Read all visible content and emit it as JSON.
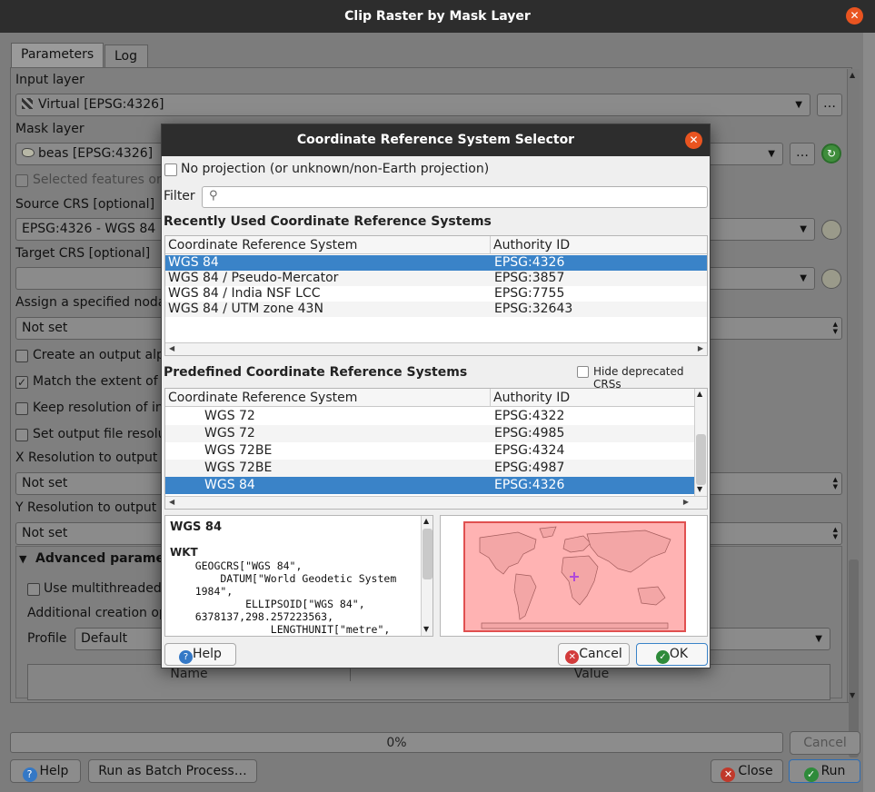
{
  "window": {
    "title": "Clip Raster by Mask Layer"
  },
  "tabs": [
    {
      "label": "Parameters",
      "active": true
    },
    {
      "label": "Log",
      "active": false
    }
  ],
  "params": {
    "input_layer_label": "Input layer",
    "input_layer_value": "Virtual [EPSG:4326]",
    "mask_layer_label": "Mask layer",
    "mask_layer_value": "beas [EPSG:4326]",
    "selected_features_label": "Selected features on",
    "source_crs_label": "Source CRS [optional]",
    "source_crs_value": "EPSG:4326 - WGS 84",
    "target_crs_label": "Target CRS [optional]",
    "target_crs_value": "",
    "nodata_label": "Assign a specified nodal",
    "nodata_value": "Not set",
    "alpha_label": "Create an output alp",
    "match_extent_label": "Match the extent of t",
    "keep_resolution_label": "Keep resolution of in",
    "set_resolution_label": "Set output file resolu",
    "x_res_label": "X Resolution to output l",
    "x_res_value": "Not set",
    "y_res_label": "Y Resolution to output l",
    "y_res_value": "Not set",
    "advanced_label": "Advanced paramete",
    "multithreaded_label": "Use multithreaded",
    "creation_options_label": "Additional creation op",
    "profile_label": "Profile",
    "profile_value": "Default",
    "table_headers": [
      "Name",
      "Value"
    ],
    "browse_btn": "…"
  },
  "bottom": {
    "progress_text": "0%",
    "progress_value": 0,
    "cancel": "Cancel",
    "help": "Help",
    "batch": "Run as Batch Process…",
    "close": "Close",
    "run": "Run"
  },
  "dialog": {
    "title": "Coordinate Reference System Selector",
    "no_projection": "No projection (or unknown/non-Earth projection)",
    "filter_label": "Filter",
    "filter_value": "",
    "recent_title": "Recently Used Coordinate Reference Systems",
    "col_crs": "Coordinate Reference System",
    "col_auth": "Authority ID",
    "recent_rows": [
      {
        "name": "WGS 84",
        "auth": "EPSG:4326",
        "selected": true
      },
      {
        "name": "WGS 84 / Pseudo-Mercator",
        "auth": "EPSG:3857"
      },
      {
        "name": "WGS 84 / India NSF LCC",
        "auth": "EPSG:7755"
      },
      {
        "name": "WGS 84 / UTM zone 43N",
        "auth": "EPSG:32643"
      }
    ],
    "predefined_title": "Predefined Coordinate Reference Systems",
    "hide_deprecated": "Hide deprecated CRSs",
    "predefined_rows": [
      {
        "name": "WGS 72",
        "auth": "EPSG:4322"
      },
      {
        "name": "WGS 72",
        "auth": "EPSG:4985"
      },
      {
        "name": "WGS 72BE",
        "auth": "EPSG:4324"
      },
      {
        "name": "WGS 72BE",
        "auth": "EPSG:4987"
      },
      {
        "name": "WGS 84",
        "auth": "EPSG:4326",
        "selected": true
      }
    ],
    "details_name": "WGS 84",
    "details_wkt_label": "WKT",
    "details_wkt": "    GEOGCRS[\"WGS 84\",\n        DATUM[\"World Geodetic System\n    1984\",\n            ELLIPSOID[\"WGS 84\",\n    6378137,298.257223563,\n                LENGTHUNIT[\"metre\",",
    "help": "Help",
    "cancel": "Cancel",
    "ok": "OK"
  },
  "colors": {
    "selection": "#3a83c8",
    "close_button": "#e95420",
    "map_extent": "#ff9c9c"
  }
}
